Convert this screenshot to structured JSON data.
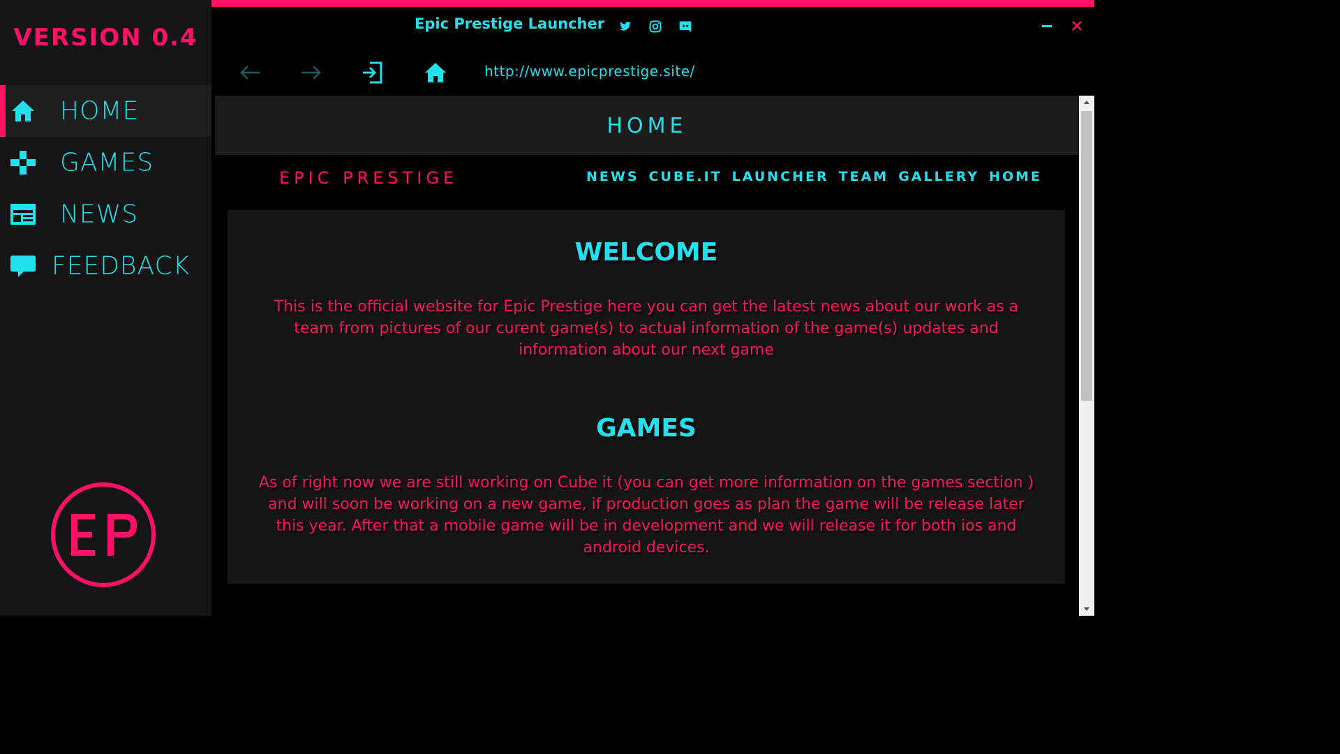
{
  "sidebar": {
    "version": "VERSION 0.4",
    "items": [
      {
        "label": "HOME",
        "icon": "home-icon",
        "active": true
      },
      {
        "label": "GAMES",
        "icon": "gamepad-icon",
        "active": false
      },
      {
        "label": "NEWS",
        "icon": "newspaper-icon",
        "active": false
      },
      {
        "label": "FEEDBACK",
        "icon": "chat-bubble-icon",
        "active": false
      }
    ],
    "logo_text": "EP"
  },
  "titlebar": {
    "title": "Epic Prestige Launcher",
    "social_icons": [
      "twitter-icon",
      "instagram-icon",
      "discord-icon"
    ],
    "minimize_glyph": "−",
    "close_glyph": "×"
  },
  "browser": {
    "url": "http://www.epicprestige.site/",
    "nav_icons": [
      "back-arrow-icon",
      "forward-arrow-icon",
      "login-icon",
      "home-icon"
    ]
  },
  "page": {
    "header_title": "HOME",
    "brand": "EPIC PRESTIGE",
    "menu": [
      "NEWS",
      "CUBE.IT",
      "LAUNCHER",
      "TEAM",
      "GALLERY",
      "HOME"
    ],
    "sections": [
      {
        "heading": "WELCOME",
        "text": "This is the official website for Epic Prestige here you can get the latest news about our work as a team from pictures of our curent game(s) to actual information of the game(s) updates and information about our next game"
      },
      {
        "heading": "GAMES",
        "text": "As of right now we are still working on Cube it (you can get more information on the games section ) and will soon be working on a new game, if production goes as plan the game  will be release later this year. After that a mobile game will be in development and we will release it for both ios and android devices."
      }
    ]
  },
  "colors": {
    "accent_pink": "#ff1166",
    "accent_cyan": "#22e0ee",
    "sidebar_bg": "#151515",
    "card_bg": "#151515"
  }
}
